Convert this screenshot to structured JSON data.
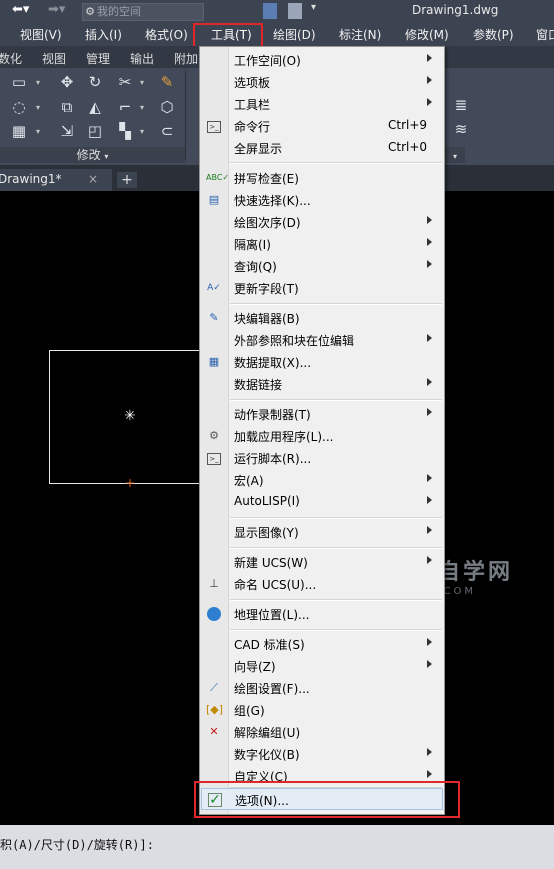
{
  "titlebar": {
    "workspace_combo": "我的空间",
    "document_title": "Drawing1.dwg"
  },
  "menubar": {
    "items": [
      "视图(V)",
      "插入(I)",
      "格式(O)",
      "工具(T)",
      "绘图(D)",
      "标注(N)",
      "修改(M)",
      "参数(P)",
      "窗口"
    ],
    "active": "工具(T)"
  },
  "ribbon": {
    "tabs": [
      "数化",
      "视图",
      "管理",
      "输出",
      "附加"
    ],
    "panel_title": "修改"
  },
  "filetab": {
    "name": "Drawing1*",
    "close": "×",
    "add": "+"
  },
  "watermark": {
    "main": "软件自学网",
    "sub": "RJZXW.COM"
  },
  "commandline": {
    "text": "积(A)/尺寸(D)/旋转(R)]:"
  },
  "menu": {
    "items": [
      {
        "label": "工作空间(O)",
        "shortcut": "",
        "submenu": true,
        "icon": ""
      },
      {
        "label": "选项板",
        "shortcut": "",
        "submenu": true,
        "icon": ""
      },
      {
        "label": "工具栏",
        "shortcut": "",
        "submenu": true,
        "icon": ""
      },
      {
        "label": "命令行",
        "shortcut": "Ctrl+9",
        "submenu": false,
        "icon": "command-line-icon"
      },
      {
        "label": "全屏显示",
        "shortcut": "Ctrl+0",
        "submenu": false,
        "icon": ""
      },
      {
        "label": "拼写检查(E)",
        "shortcut": "",
        "submenu": false,
        "icon": "spell-check-icon"
      },
      {
        "label": "快速选择(K)...",
        "shortcut": "",
        "submenu": false,
        "icon": "quick-select-icon"
      },
      {
        "label": "绘图次序(D)",
        "shortcut": "",
        "submenu": true,
        "icon": ""
      },
      {
        "label": "隔离(I)",
        "shortcut": "",
        "submenu": true,
        "icon": ""
      },
      {
        "label": "查询(Q)",
        "shortcut": "",
        "submenu": true,
        "icon": ""
      },
      {
        "label": "更新字段(T)",
        "shortcut": "",
        "submenu": false,
        "icon": "update-field-icon"
      },
      {
        "label": "块编辑器(B)",
        "shortcut": "",
        "submenu": false,
        "icon": "block-editor-icon"
      },
      {
        "label": "外部参照和块在位编辑",
        "shortcut": "",
        "submenu": true,
        "icon": ""
      },
      {
        "label": "数据提取(X)...",
        "shortcut": "",
        "submenu": false,
        "icon": "data-extraction-icon"
      },
      {
        "label": "数据链接",
        "shortcut": "",
        "submenu": true,
        "icon": ""
      },
      {
        "label": "动作录制器(T)",
        "shortcut": "",
        "submenu": true,
        "icon": ""
      },
      {
        "label": "加载应用程序(L)...",
        "shortcut": "",
        "submenu": false,
        "icon": "load-application-icon"
      },
      {
        "label": "运行脚本(R)...",
        "shortcut": "",
        "submenu": false,
        "icon": "run-script-icon"
      },
      {
        "label": "宏(A)",
        "shortcut": "",
        "submenu": true,
        "icon": ""
      },
      {
        "label": "AutoLISP(I)",
        "shortcut": "",
        "submenu": true,
        "icon": ""
      },
      {
        "label": "显示图像(Y)",
        "shortcut": "",
        "submenu": true,
        "icon": ""
      },
      {
        "label": "新建 UCS(W)",
        "shortcut": "",
        "submenu": true,
        "icon": ""
      },
      {
        "label": "命名 UCS(U)...",
        "shortcut": "",
        "submenu": false,
        "icon": "named-ucs-icon"
      },
      {
        "label": "地理位置(L)...",
        "shortcut": "",
        "submenu": false,
        "icon": "globe-icon"
      },
      {
        "label": "CAD 标准(S)",
        "shortcut": "",
        "submenu": true,
        "icon": ""
      },
      {
        "label": "向导(Z)",
        "shortcut": "",
        "submenu": true,
        "icon": ""
      },
      {
        "label": "绘图设置(F)...",
        "shortcut": "",
        "submenu": false,
        "icon": "drafting-settings-icon"
      },
      {
        "label": "组(G)",
        "shortcut": "",
        "submenu": false,
        "icon": "group-icon"
      },
      {
        "label": "解除编组(U)",
        "shortcut": "",
        "submenu": false,
        "icon": "ungroup-icon"
      },
      {
        "label": "数字化仪(B)",
        "shortcut": "",
        "submenu": true,
        "icon": ""
      },
      {
        "label": "自定义(C)",
        "shortcut": "",
        "submenu": true,
        "icon": ""
      },
      {
        "label": "选项(N)...",
        "shortcut": "",
        "submenu": false,
        "icon": "options-check-icon"
      }
    ]
  },
  "colors": {
    "highlight_border": "#e0282b",
    "menubar_bg": "#3d4451",
    "menu_bg": "#f0f0f0"
  }
}
